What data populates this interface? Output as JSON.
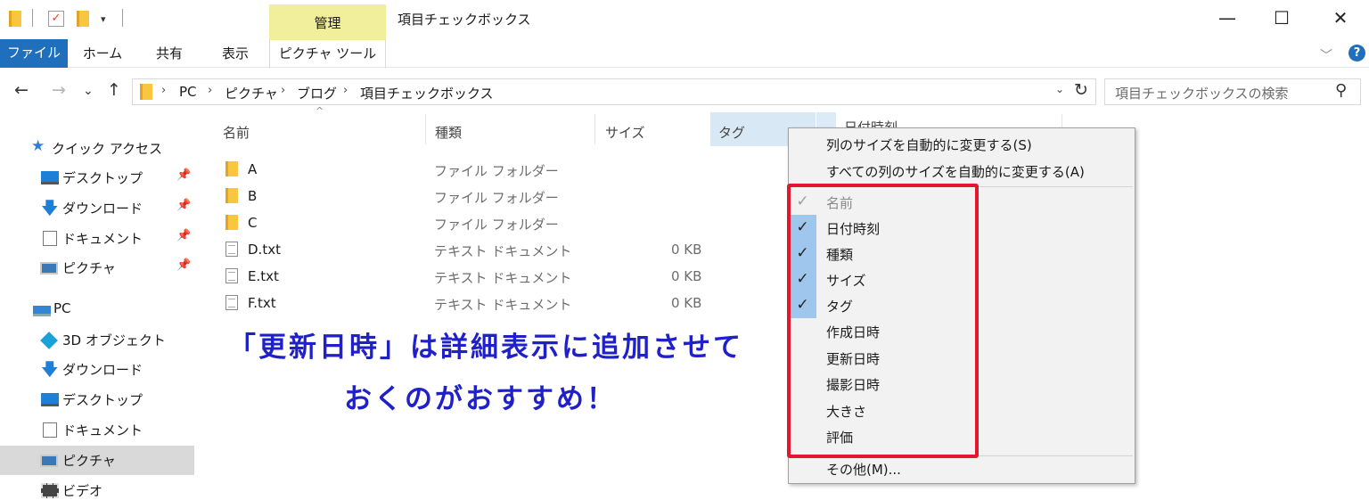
{
  "window": {
    "title": "項目チェックボックス",
    "context_tab": "管理",
    "min": "—",
    "max": "☐",
    "close": "✕"
  },
  "quick_access_toolbar": {
    "dropdown": "▾"
  },
  "ribbon": {
    "tabs": [
      "ファイル",
      "ホーム",
      "共有",
      "表示",
      "ピクチャ ツール"
    ],
    "collapse": "﹀",
    "help": "?"
  },
  "address": {
    "back": "←",
    "forward": "→",
    "recent": "⌄",
    "up": "↑",
    "crumbs": [
      "PC",
      "ピクチャ",
      "ブログ",
      "項目チェックボックス"
    ],
    "sep": "›",
    "dropdown": "⌄",
    "refresh": "↻"
  },
  "search": {
    "placeholder": "項目チェックボックスの検索",
    "icon": "⚲"
  },
  "sidebar": {
    "quick_access": "クイック アクセス",
    "pin": "📌",
    "quick_items": [
      "デスクトップ",
      "ダウンロード",
      "ドキュメント",
      "ピクチャ"
    ],
    "pc": "PC",
    "pc_items": [
      "3D オブジェクト",
      "ダウンロード",
      "デスクトップ",
      "ドキュメント",
      "ピクチャ",
      "ビデオ"
    ],
    "selected": "ピクチャ"
  },
  "columns": {
    "name": "名前",
    "type": "種類",
    "size": "サイズ",
    "tag": "タグ",
    "date": "日付時刻",
    "sort_indicator": "^"
  },
  "files": [
    {
      "name": "A",
      "type": "ファイル フォルダー",
      "size": "",
      "kind": "folder"
    },
    {
      "name": "B",
      "type": "ファイル フォルダー",
      "size": "",
      "kind": "folder"
    },
    {
      "name": "C",
      "type": "ファイル フォルダー",
      "size": "",
      "kind": "folder"
    },
    {
      "name": "D.txt",
      "type": "テキスト ドキュメント",
      "size": "0 KB",
      "kind": "text"
    },
    {
      "name": "E.txt",
      "type": "テキスト ドキュメント",
      "size": "0 KB",
      "kind": "text"
    },
    {
      "name": "F.txt",
      "type": "テキスト ドキュメント",
      "size": "0 KB",
      "kind": "text"
    }
  ],
  "annotation": {
    "line1": "「更新日時」は詳細表示に追加させて",
    "line2": "おくのがおすすめ！",
    "color": "#2020c8"
  },
  "context_menu": {
    "autosize": "列のサイズを自動的に変更する(S)",
    "autosize_all": "すべての列のサイズを自動的に変更する(A)",
    "check_mark": "✓",
    "columns": [
      {
        "label": "名前",
        "checked": true,
        "disabled": true
      },
      {
        "label": "日付時刻",
        "checked": true,
        "disabled": false
      },
      {
        "label": "種類",
        "checked": true,
        "disabled": false
      },
      {
        "label": "サイズ",
        "checked": true,
        "disabled": false
      },
      {
        "label": "タグ",
        "checked": true,
        "disabled": false
      },
      {
        "label": "作成日時",
        "checked": false,
        "disabled": false
      },
      {
        "label": "更新日時",
        "checked": false,
        "disabled": false
      },
      {
        "label": "撮影日時",
        "checked": false,
        "disabled": false
      },
      {
        "label": "大きさ",
        "checked": false,
        "disabled": false
      },
      {
        "label": "評価",
        "checked": false,
        "disabled": false
      }
    ],
    "more": "その他(M)...",
    "highlight_color": "#e3162f"
  }
}
